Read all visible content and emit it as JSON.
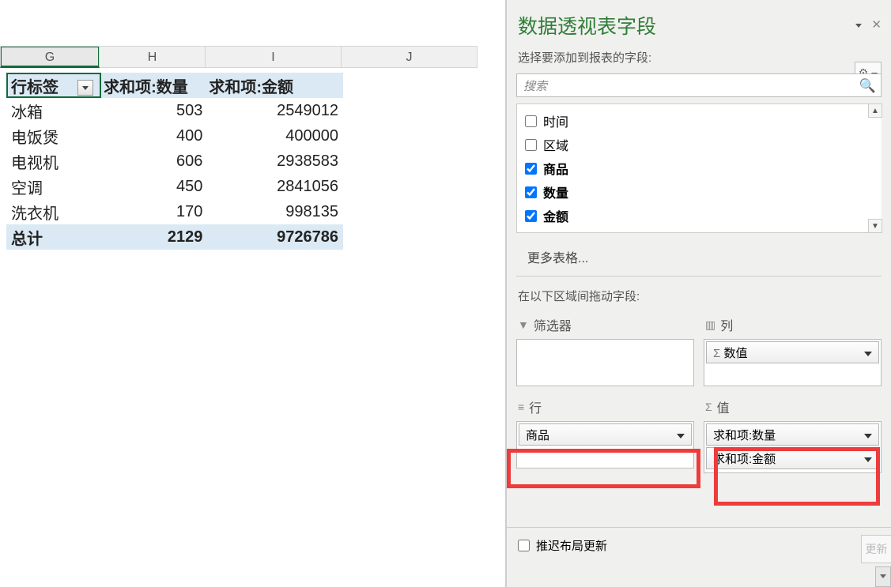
{
  "columns": {
    "G": "G",
    "H": "H",
    "I": "I",
    "J": "J"
  },
  "pivot": {
    "headers": {
      "rowlabel": "行标签",
      "qty": "求和项:数量",
      "amount": "求和项:金额"
    },
    "rows": [
      {
        "label": "冰箱",
        "qty": "503",
        "amount": "2549012"
      },
      {
        "label": "电饭煲",
        "qty": "400",
        "amount": "400000"
      },
      {
        "label": "电视机",
        "qty": "606",
        "amount": "2938583"
      },
      {
        "label": "空调",
        "qty": "450",
        "amount": "2841056"
      },
      {
        "label": "洗衣机",
        "qty": "170",
        "amount": "998135"
      }
    ],
    "total": {
      "label": "总计",
      "qty": "2129",
      "amount": "9726786"
    }
  },
  "pane": {
    "title": "数据透视表字段",
    "subtitle": "选择要添加到报表的字段:",
    "search_placeholder": "搜索",
    "fields": [
      {
        "name": "时间",
        "checked": false
      },
      {
        "name": "区域",
        "checked": false
      },
      {
        "name": "商品",
        "checked": true
      },
      {
        "name": "数量",
        "checked": true
      },
      {
        "name": "金额",
        "checked": true
      }
    ],
    "more_tables": "更多表格...",
    "drag_label": "在以下区域间拖动字段:",
    "areas": {
      "filter": {
        "title": "筛选器"
      },
      "columns": {
        "title": "列",
        "chip": "数值"
      },
      "rows": {
        "title": "行",
        "chip": "商品"
      },
      "values": {
        "title": "值",
        "chips": [
          "求和项:数量",
          "求和项:金额"
        ]
      }
    },
    "defer": "推迟布局更新",
    "update": "更新"
  },
  "chart_data": {
    "type": "table",
    "title": "数据透视表",
    "columns": [
      "行标签",
      "求和项:数量",
      "求和项:金额"
    ],
    "rows": [
      [
        "冰箱",
        503,
        2549012
      ],
      [
        "电饭煲",
        400,
        400000
      ],
      [
        "电视机",
        606,
        2938583
      ],
      [
        "空调",
        450,
        2841056
      ],
      [
        "洗衣机",
        170,
        998135
      ],
      [
        "总计",
        2129,
        9726786
      ]
    ]
  }
}
